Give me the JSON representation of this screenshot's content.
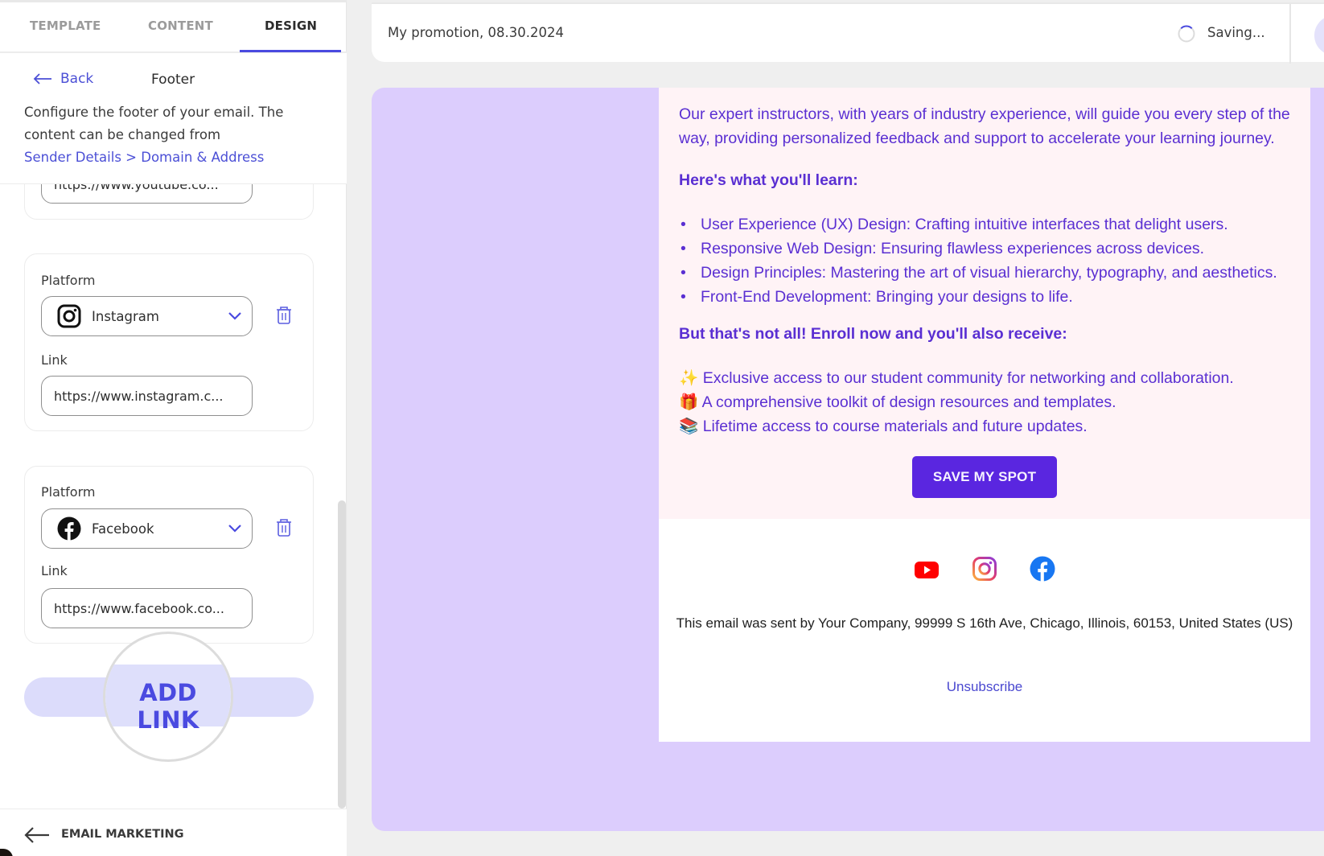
{
  "tabs": [
    {
      "label": "TEMPLATE",
      "active": false
    },
    {
      "label": "CONTENT",
      "active": false
    },
    {
      "label": "DESIGN",
      "active": true
    }
  ],
  "panel": {
    "back_label": "Back",
    "title": "Footer",
    "description": "Configure the footer of your email. The content can be changed from",
    "description_link": "Sender Details > Domain & Address",
    "partial_link_value": "https://www.youtube.co...",
    "social_links": [
      {
        "platform_label": "Platform",
        "platform": "Instagram",
        "platform_icon": "instagram-icon",
        "link_label": "Link",
        "link_value": "https://www.instagram.c..."
      },
      {
        "platform_label": "Platform",
        "platform": "Facebook",
        "platform_icon": "facebook-icon",
        "link_label": "Link",
        "link_value": "https://www.facebook.co..."
      }
    ],
    "add_link_label": "ADD LINK",
    "bottom_nav_label": "EMAIL MARKETING"
  },
  "topbar": {
    "title": "My promotion, 08.30.2024",
    "status": "Saving..."
  },
  "email": {
    "intro": "Our expert instructors, with years of industry experience, will guide you every step of the way, providing personalized feedback and support to accelerate your learning journey.",
    "learn_heading": "Here's what you'll learn:",
    "learn_items": [
      "User Experience (UX) Design: Crafting intuitive interfaces that delight users.",
      "Responsive Web Design: Ensuring flawless experiences across devices.",
      "Design Principles: Mastering the art of visual hierarchy, typography, and aesthetics.",
      "Front-End Development: Bringing your designs to life."
    ],
    "bonus_heading": "But that's not all! Enroll now and you'll also receive:",
    "bonus_items": [
      {
        "emoji": "✨",
        "text": "Exclusive access to our student community for networking and collaboration."
      },
      {
        "emoji": "🎁",
        "text": "A comprehensive toolkit of design resources and templates."
      },
      {
        "emoji": "📚",
        "text": "Lifetime access to course materials and future updates."
      }
    ],
    "cta_label": "SAVE MY SPOT",
    "social_icons": [
      "youtube-icon",
      "instagram-icon",
      "facebook-icon"
    ],
    "address": "This email was sent by Your Company, 99999 S 16th Ave, Chicago, Illinois, 60153, United States (US)",
    "unsubscribe_label": "Unsubscribe"
  },
  "colors": {
    "accent": "#4a4ae0",
    "email_text": "#5a2fd2",
    "cta_bg": "#5a26e0",
    "canvas_bg": "#dccdfd",
    "email_body_bg": "#fff3f6"
  }
}
